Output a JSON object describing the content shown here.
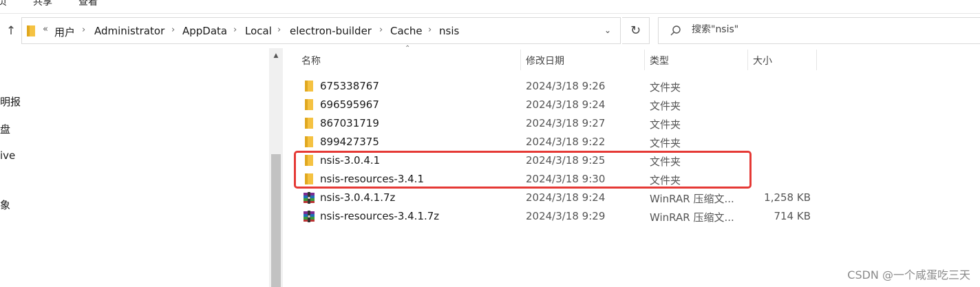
{
  "ribbon": {
    "tabs": [
      "页",
      "共享",
      "查看"
    ]
  },
  "address": {
    "overflow": "«",
    "crumbs": [
      "用户",
      "Administrator",
      "AppData",
      "Local",
      "electron-builder",
      "Cache",
      "nsis"
    ],
    "separator": "›"
  },
  "search": {
    "placeholder": "搜索\"nsis\""
  },
  "nav": {
    "items": [
      "明报",
      "盘",
      "ive",
      "象"
    ]
  },
  "columns": {
    "name": "名称",
    "date": "修改日期",
    "type": "类型",
    "size": "大小"
  },
  "files": [
    {
      "icon": "folder-icon",
      "name": "675338767",
      "date": "2024/3/18 9:26",
      "type": "文件夹",
      "size": ""
    },
    {
      "icon": "folder-icon",
      "name": "696595967",
      "date": "2024/3/18 9:24",
      "type": "文件夹",
      "size": ""
    },
    {
      "icon": "folder-icon",
      "name": "867031719",
      "date": "2024/3/18 9:27",
      "type": "文件夹",
      "size": ""
    },
    {
      "icon": "folder-icon",
      "name": "899427375",
      "date": "2024/3/18 9:22",
      "type": "文件夹",
      "size": ""
    },
    {
      "icon": "folder-icon",
      "name": "nsis-3.0.4.1",
      "date": "2024/3/18 9:25",
      "type": "文件夹",
      "size": ""
    },
    {
      "icon": "folder-icon",
      "name": "nsis-resources-3.4.1",
      "date": "2024/3/18 9:30",
      "type": "文件夹",
      "size": ""
    },
    {
      "icon": "winrar-archive-icon",
      "name": "nsis-3.0.4.1.7z",
      "date": "2024/3/18 9:24",
      "type": "WinRAR 压缩文...",
      "size": "1,258 KB"
    },
    {
      "icon": "winrar-archive-icon",
      "name": "nsis-resources-3.4.1.7z",
      "date": "2024/3/18 9:29",
      "type": "WinRAR 压缩文...",
      "size": "714 KB"
    }
  ],
  "watermark": "CSDN @一个咸蛋吃三天",
  "colors": {
    "highlight": "#e53935",
    "folder": "#f5c242",
    "accent": "#0078d4"
  }
}
